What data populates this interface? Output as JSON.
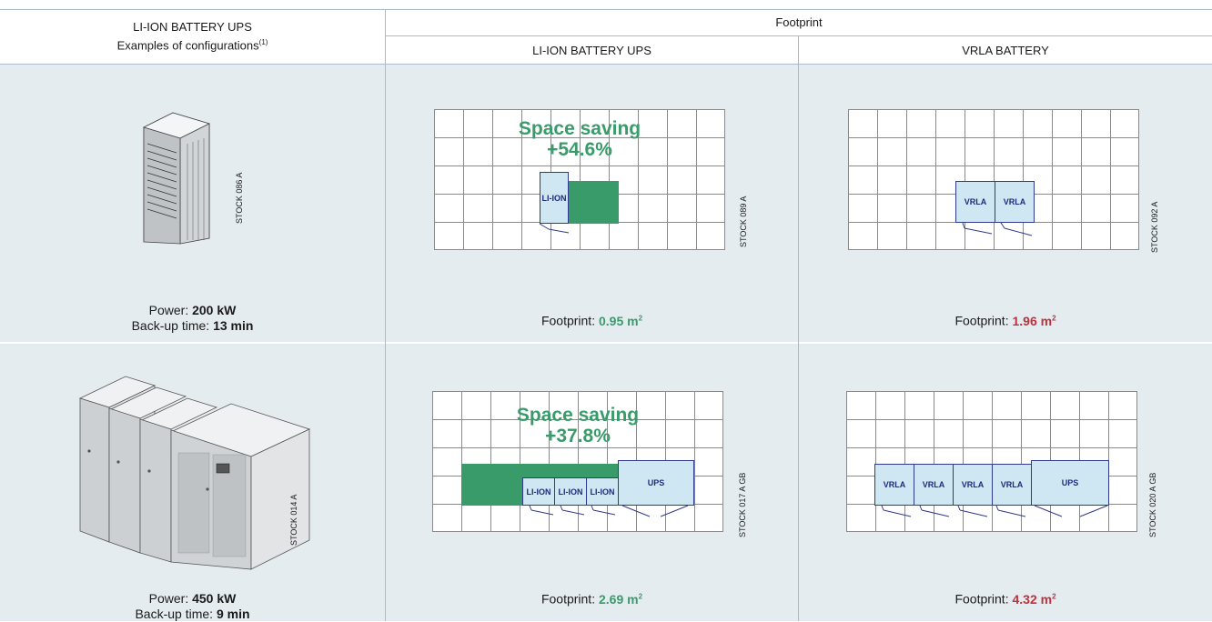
{
  "header": {
    "col1_line1": "LI-ION BATTERY UPS",
    "col1_line2": "Examples of configurations",
    "col1_sup": "(1)",
    "footprint": "Footprint",
    "col2": "LI-ION BATTERY UPS",
    "col3": "VRLA BATTERY"
  },
  "rows": [
    {
      "power_label": "Power: ",
      "power_value": "200 kW",
      "backup_label": "Back-up time: ",
      "backup_value": "13 min",
      "ups_stock": "STOCK 086 A",
      "liion_stock": "STOCK 089 A",
      "vrla_stock": "STOCK 092 A",
      "saving_title": "Space saving",
      "saving_value": "+54.6%",
      "liion_box": "LI-ION",
      "vrla_box_1": "VRLA",
      "vrla_box_2": "VRLA",
      "fp_label_liion": "Footprint: ",
      "fp_value_liion": "0.95 m",
      "fp_label_vrla": "Footprint: ",
      "fp_value_vrla": "1.96 m",
      "fp_sup": "2"
    },
    {
      "power_label": "Power: ",
      "power_value": "450 kW",
      "backup_label": "Back-up time: ",
      "backup_value": "9 min",
      "ups_stock": "STOCK 014 A",
      "liion_stock": "STOCK 017 A GB",
      "vrla_stock": "STOCK 020 A GB",
      "saving_title": "Space saving",
      "saving_value": "+37.8%",
      "liion_box_1": "LI-ION",
      "liion_box_2": "LI-ION",
      "liion_box_3": "LI-ION",
      "liion_ups": "UPS",
      "vrla_box_1": "VRLA",
      "vrla_box_2": "VRLA",
      "vrla_box_3": "VRLA",
      "vrla_box_4": "VRLA",
      "vrla_ups": "UPS",
      "fp_label_liion": "Footprint: ",
      "fp_value_liion": "2.69 m",
      "fp_label_vrla": "Footprint: ",
      "fp_value_vrla": "4.32 m",
      "fp_sup": "2"
    }
  ],
  "colors": {
    "green": "#3a9b6a",
    "red": "#c0303c",
    "row_bg": "#e5ecf0",
    "box_fill": "#cfe7f3",
    "box_border": "#303a8c"
  },
  "icons": [
    "ups-cabinet-small-image",
    "ups-cabinet-large-image"
  ]
}
